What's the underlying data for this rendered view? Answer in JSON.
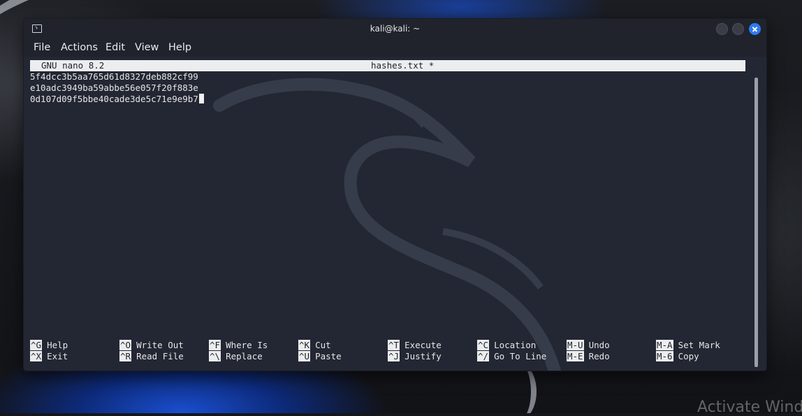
{
  "window": {
    "title": "kali@kali: ~",
    "menu": [
      "File",
      "Actions",
      "Edit",
      "View",
      "Help"
    ]
  },
  "nano": {
    "version_label": "GNU nano 8.2",
    "filename_label": "hashes.txt *",
    "lines": [
      "5f4dcc3b5aa765d61d8327deb882cf99",
      "e10adc3949ba59abbe56e057f20f883e",
      "0d107d09f5bbe40cade3de5c71e9e9b7"
    ],
    "shortcuts_row1": [
      {
        "key": "^G",
        "label": "Help"
      },
      {
        "key": "^O",
        "label": "Write Out"
      },
      {
        "key": "^F",
        "label": "Where Is"
      },
      {
        "key": "^K",
        "label": "Cut"
      },
      {
        "key": "^T",
        "label": "Execute"
      },
      {
        "key": "^C",
        "label": "Location"
      },
      {
        "key": "M-U",
        "label": "Undo"
      },
      {
        "key": "M-A",
        "label": "Set Mark"
      }
    ],
    "shortcuts_row2": [
      {
        "key": "^X",
        "label": "Exit"
      },
      {
        "key": "^R",
        "label": "Read File"
      },
      {
        "key": "^\\",
        "label": "Replace"
      },
      {
        "key": "^U",
        "label": "Paste"
      },
      {
        "key": "^J",
        "label": "Justify"
      },
      {
        "key": "^/",
        "label": "Go To Line"
      },
      {
        "key": "M-E",
        "label": "Redo"
      },
      {
        "key": "M-6",
        "label": "Copy"
      }
    ]
  },
  "desktop": {
    "watermark": "Activate Wind"
  },
  "colors": {
    "terminal_bg": "#232733",
    "close_button": "#2d7bf0",
    "wallpaper_accent": "#1a4fd0"
  }
}
